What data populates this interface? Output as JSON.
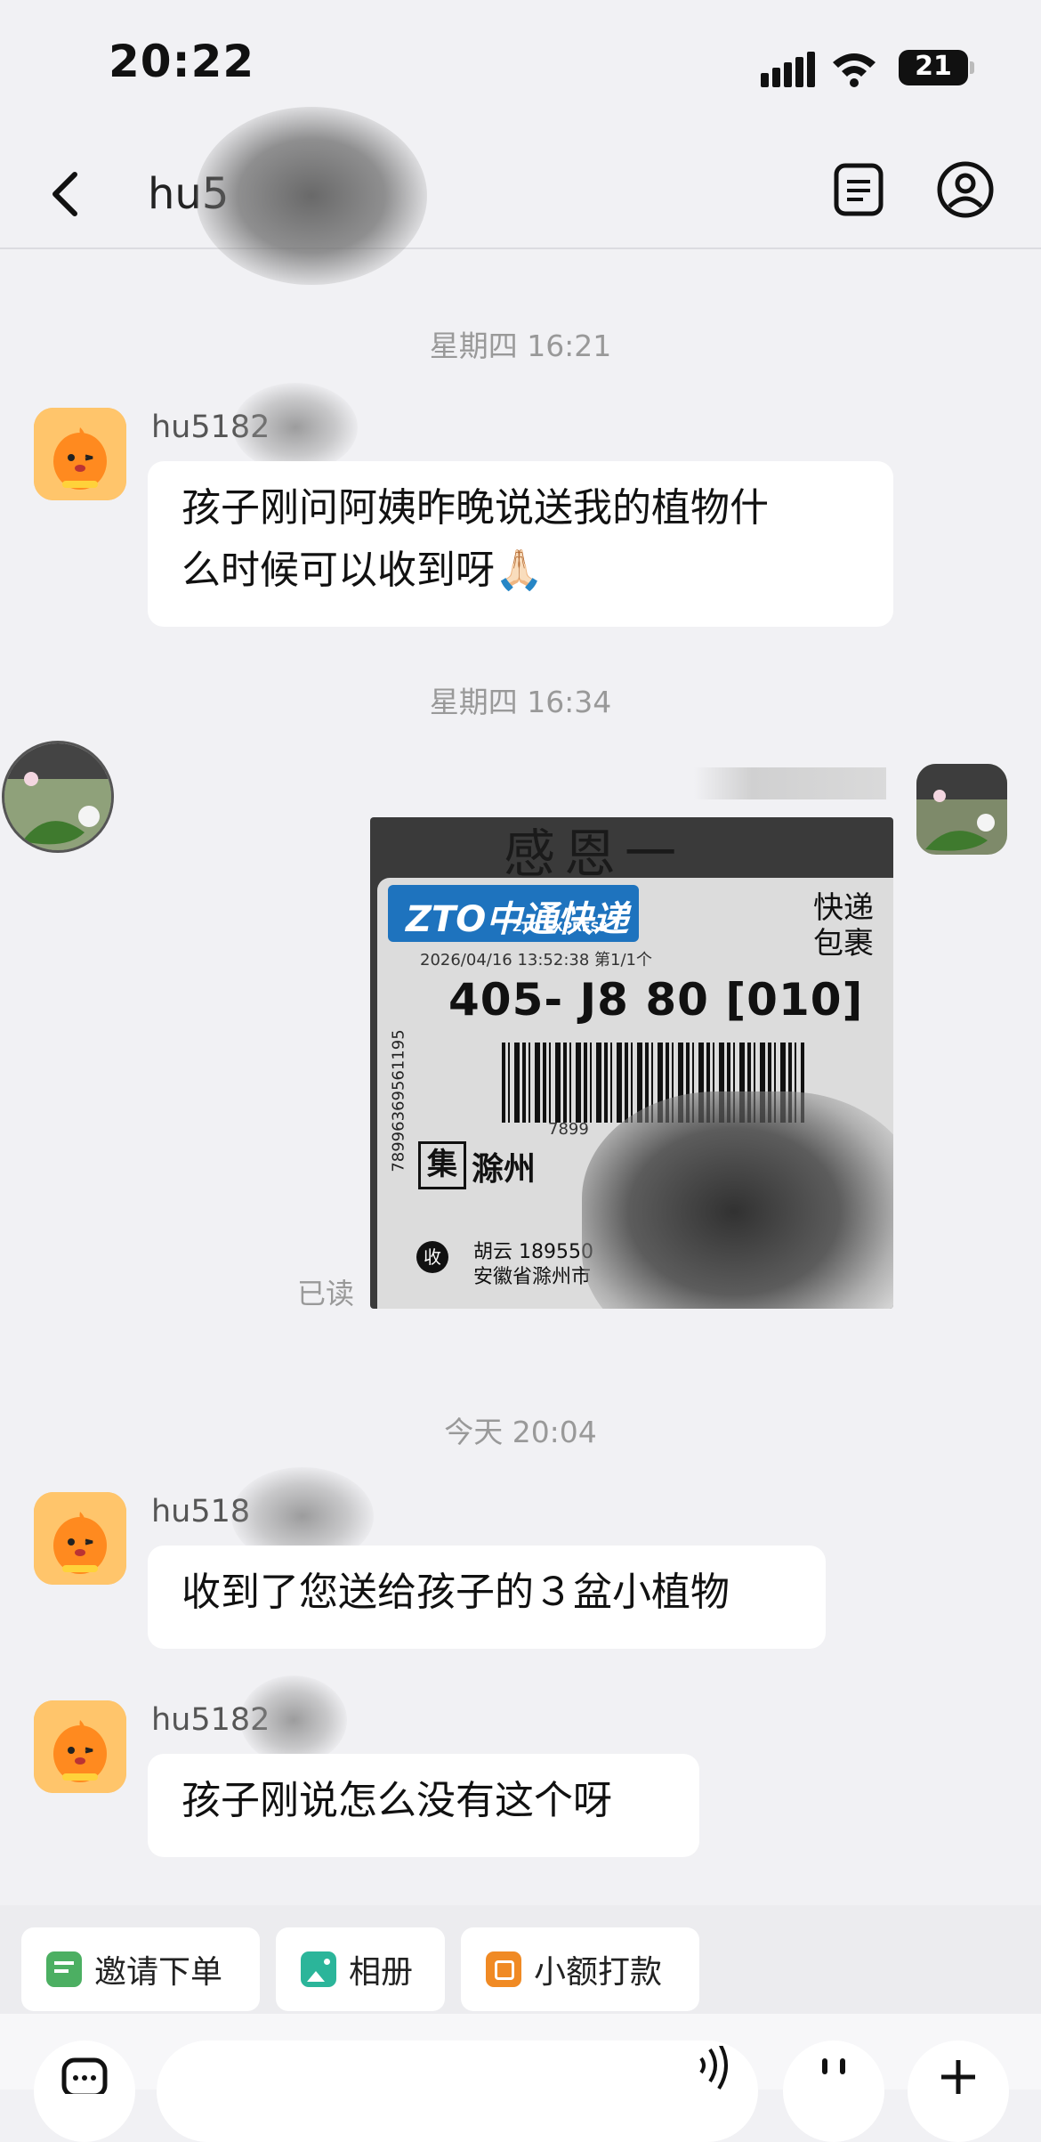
{
  "status_bar": {
    "time": "20:22",
    "battery": "21"
  },
  "header": {
    "title": "hu5"
  },
  "messages": {
    "ts1": "星期四 16:21",
    "m1_sender": "hu5182",
    "m1_line1": "孩子刚问阿姨昨晚说送我的植物什",
    "m1_line2": "么时候可以收到呀🙏🏻",
    "ts2": "星期四 16:34",
    "read_status": "已读",
    "ts3": "今天 20:04",
    "m3_sender": "hu518",
    "m3_text": "收到了您送给孩子的３盆小植物",
    "m4_sender": "hu5182",
    "m4_text": "孩子刚说怎么没有这个呀"
  },
  "shipping_label": {
    "top_text": "感恩一",
    "brand": "ZTO中通快递",
    "brand_sub": "ZTO EXPRESS",
    "type_line1": "快递",
    "type_line2": "包裹",
    "date": "2026/04/16   13:52:38   第1/1个",
    "route_code": "405- J8 80 [010]",
    "tracking_side": "78996369561195",
    "barcode_num": "7899",
    "collect_mark": "集",
    "city": "滁州",
    "receive_mark": "收",
    "receiver": "胡云    189550",
    "address": "安徽省滁州市"
  },
  "toolbar": {
    "chip1": "邀请下单",
    "chip2": "相册",
    "chip3": "小额打款"
  },
  "colors": {
    "background": "#f1f1f4",
    "bubble": "#ffffff",
    "timestamp": "#999999",
    "chip1_icon": "#4caf62",
    "chip2_icon": "#2bb59a",
    "chip3_icon": "#f08a24",
    "zto_blue": "#1e73be"
  },
  "icons": [
    "back-icon",
    "notes-icon",
    "profile-icon",
    "image-icon",
    "pay-icon",
    "invite-icon",
    "voice-icon",
    "emoji-icon",
    "plus-icon"
  ]
}
